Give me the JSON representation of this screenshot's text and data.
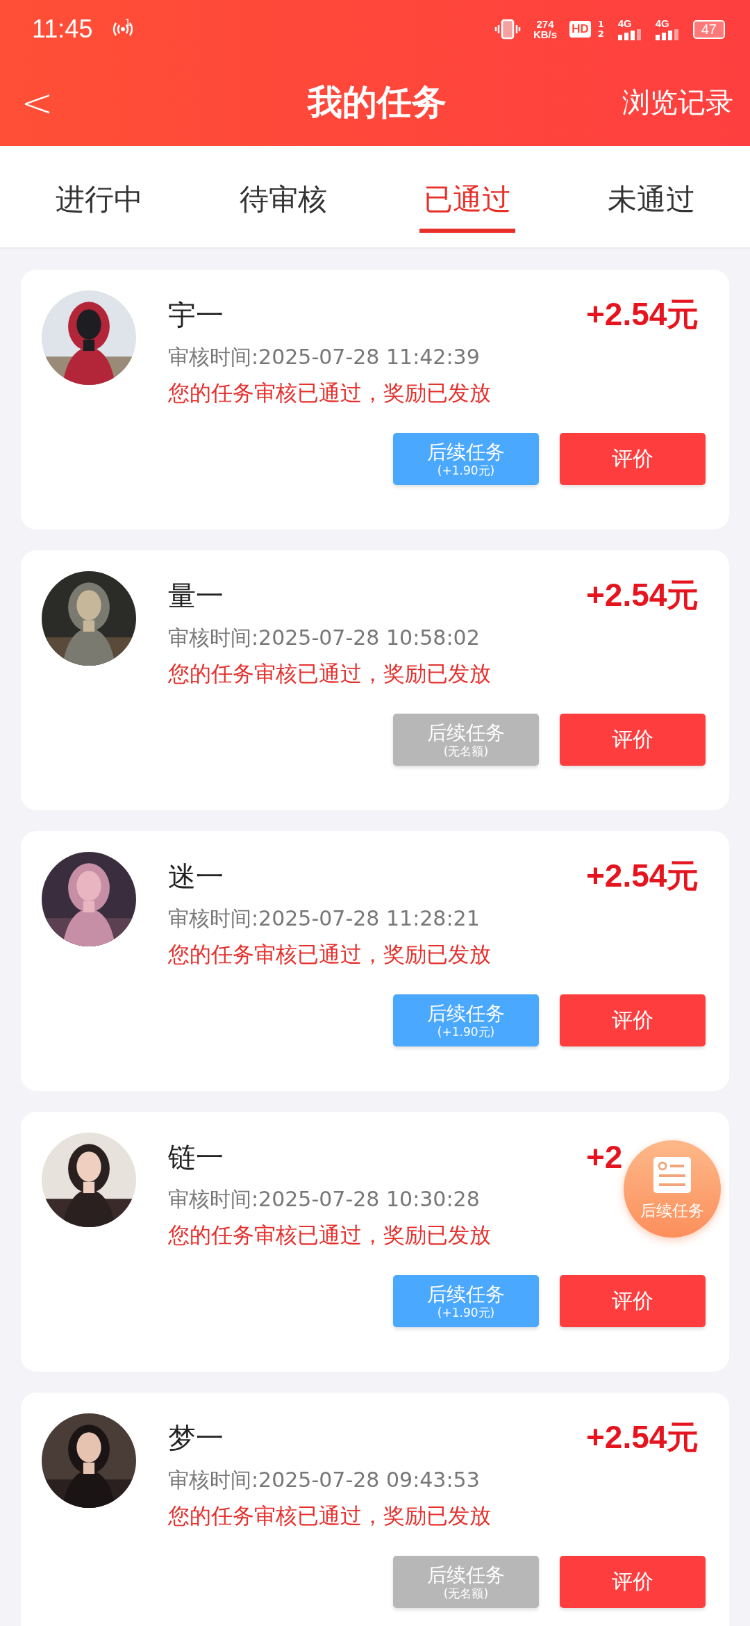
{
  "status_bar": {
    "time": "11:45",
    "hotspot_count": "1",
    "speed": "274",
    "speed_unit": "KB/s",
    "hd": "HD",
    "sim_numbers": [
      "1",
      "2"
    ],
    "networks": [
      "4G",
      "4G"
    ],
    "battery": "47"
  },
  "header": {
    "back": "<",
    "title": "我的任务",
    "action": "浏览记录"
  },
  "tabs": [
    {
      "label": "进行中",
      "selected": false
    },
    {
      "label": "待审核",
      "selected": false
    },
    {
      "label": "已通过",
      "selected": true
    },
    {
      "label": "未通过",
      "selected": false
    }
  ],
  "tasks": [
    {
      "name": "宇一",
      "amount": "+2.54元",
      "time": "审核时间:2025-07-28 11:42:39",
      "status": "您的任务审核已通过，奖励已发放",
      "followup": {
        "label": "后续任务",
        "note": "(+1.90元)",
        "disabled": false
      },
      "review": "评价"
    },
    {
      "name": "量一",
      "amount": "+2.54元",
      "time": "审核时间:2025-07-28 10:58:02",
      "status": "您的任务审核已通过，奖励已发放",
      "followup": {
        "label": "后续任务",
        "note": "(无名额)",
        "disabled": true
      },
      "review": "评价"
    },
    {
      "name": "迷一",
      "amount": "+2.54元",
      "time": "审核时间:2025-07-28 11:28:21",
      "status": "您的任务审核已通过，奖励已发放",
      "followup": {
        "label": "后续任务",
        "note": "(+1.90元)",
        "disabled": false
      },
      "review": "评价"
    },
    {
      "name": "链一",
      "amount": "+2",
      "time": "审核时间:2025-07-28 10:30:28",
      "status": "您的任务审核已通过，奖励已发放",
      "followup": {
        "label": "后续任务",
        "note": "(+1.90元)",
        "disabled": false
      },
      "review": "评价"
    },
    {
      "name": "梦一",
      "amount": "+2.54元",
      "time": "审核时间:2025-07-28 09:43:53",
      "status": "您的任务审核已通过，奖励已发放",
      "followup": {
        "label": "后续任务",
        "note": "(无名额)",
        "disabled": true
      },
      "review": "评价"
    }
  ],
  "floating_button": {
    "label": "后续任务"
  }
}
